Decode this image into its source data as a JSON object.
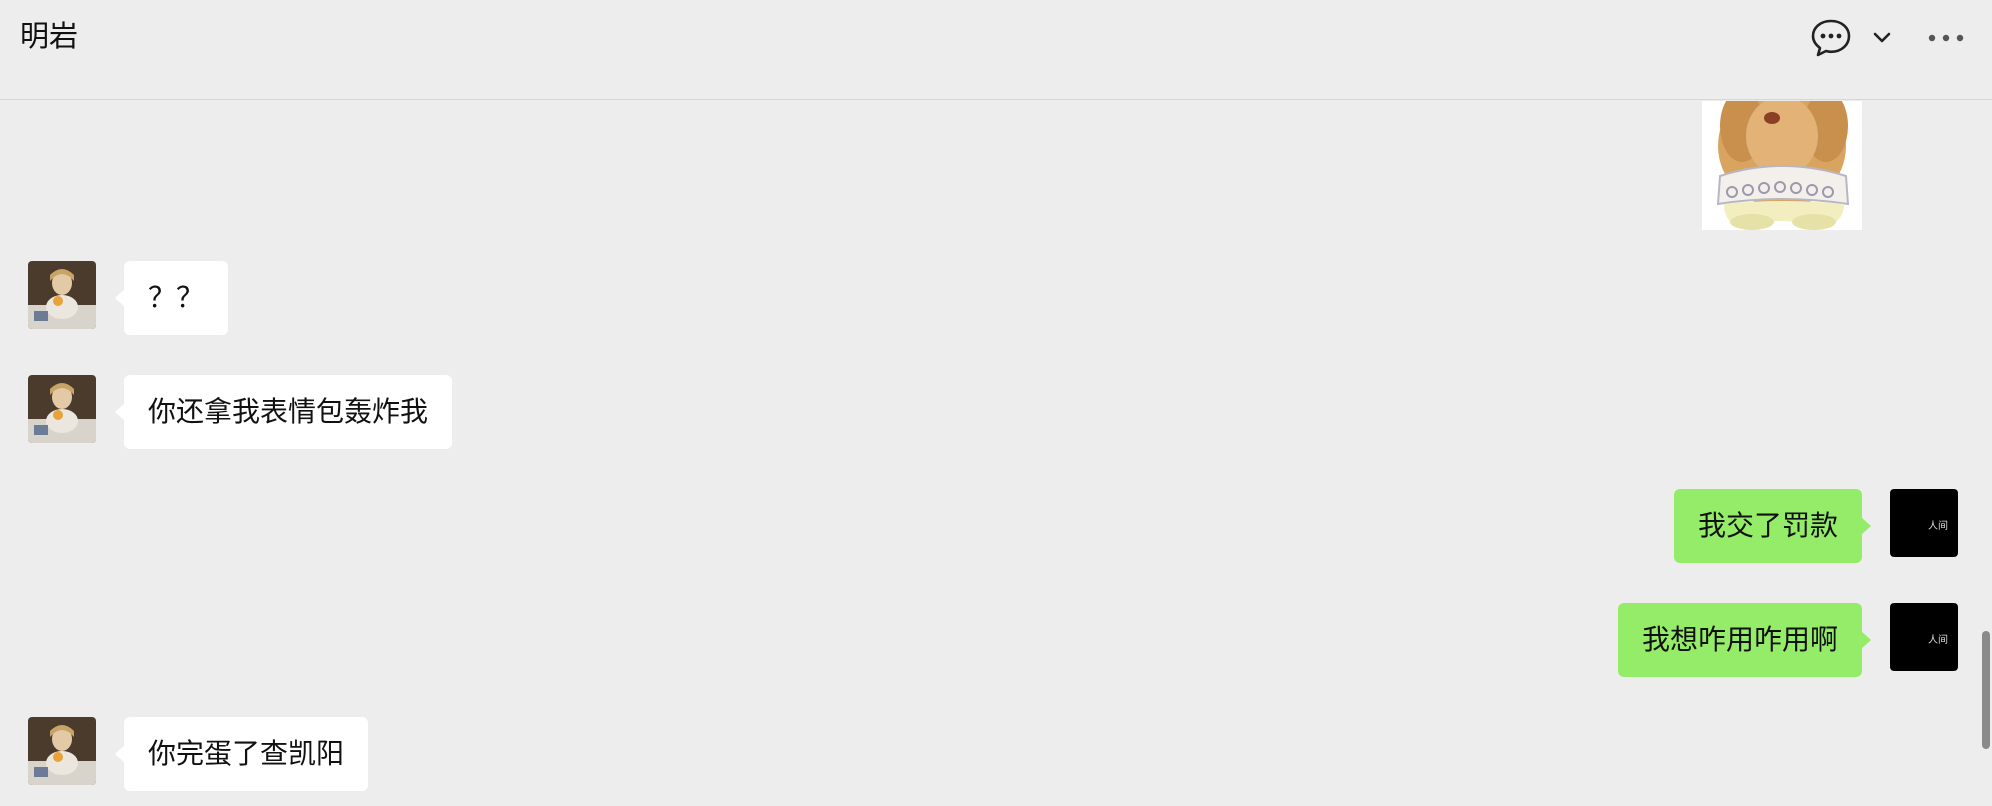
{
  "header": {
    "title": "明岩",
    "icons": [
      "chat-bubble-icon",
      "chevron-down-icon",
      "more-icon"
    ]
  },
  "messages": [
    {
      "side": "in",
      "text": "？？"
    },
    {
      "side": "in",
      "text": "你还拿我表情包轰炸我"
    },
    {
      "side": "out",
      "text": "我交了罚款"
    },
    {
      "side": "out",
      "text": "我想咋用咋用啊"
    },
    {
      "side": "in",
      "text": "你完蛋了查凯阳"
    }
  ],
  "self_avatar_text": "人间",
  "colors": {
    "background": "#ededed",
    "incoming_bubble": "#ffffff",
    "outgoing_bubble": "#95ec69",
    "self_avatar": "#000000"
  }
}
